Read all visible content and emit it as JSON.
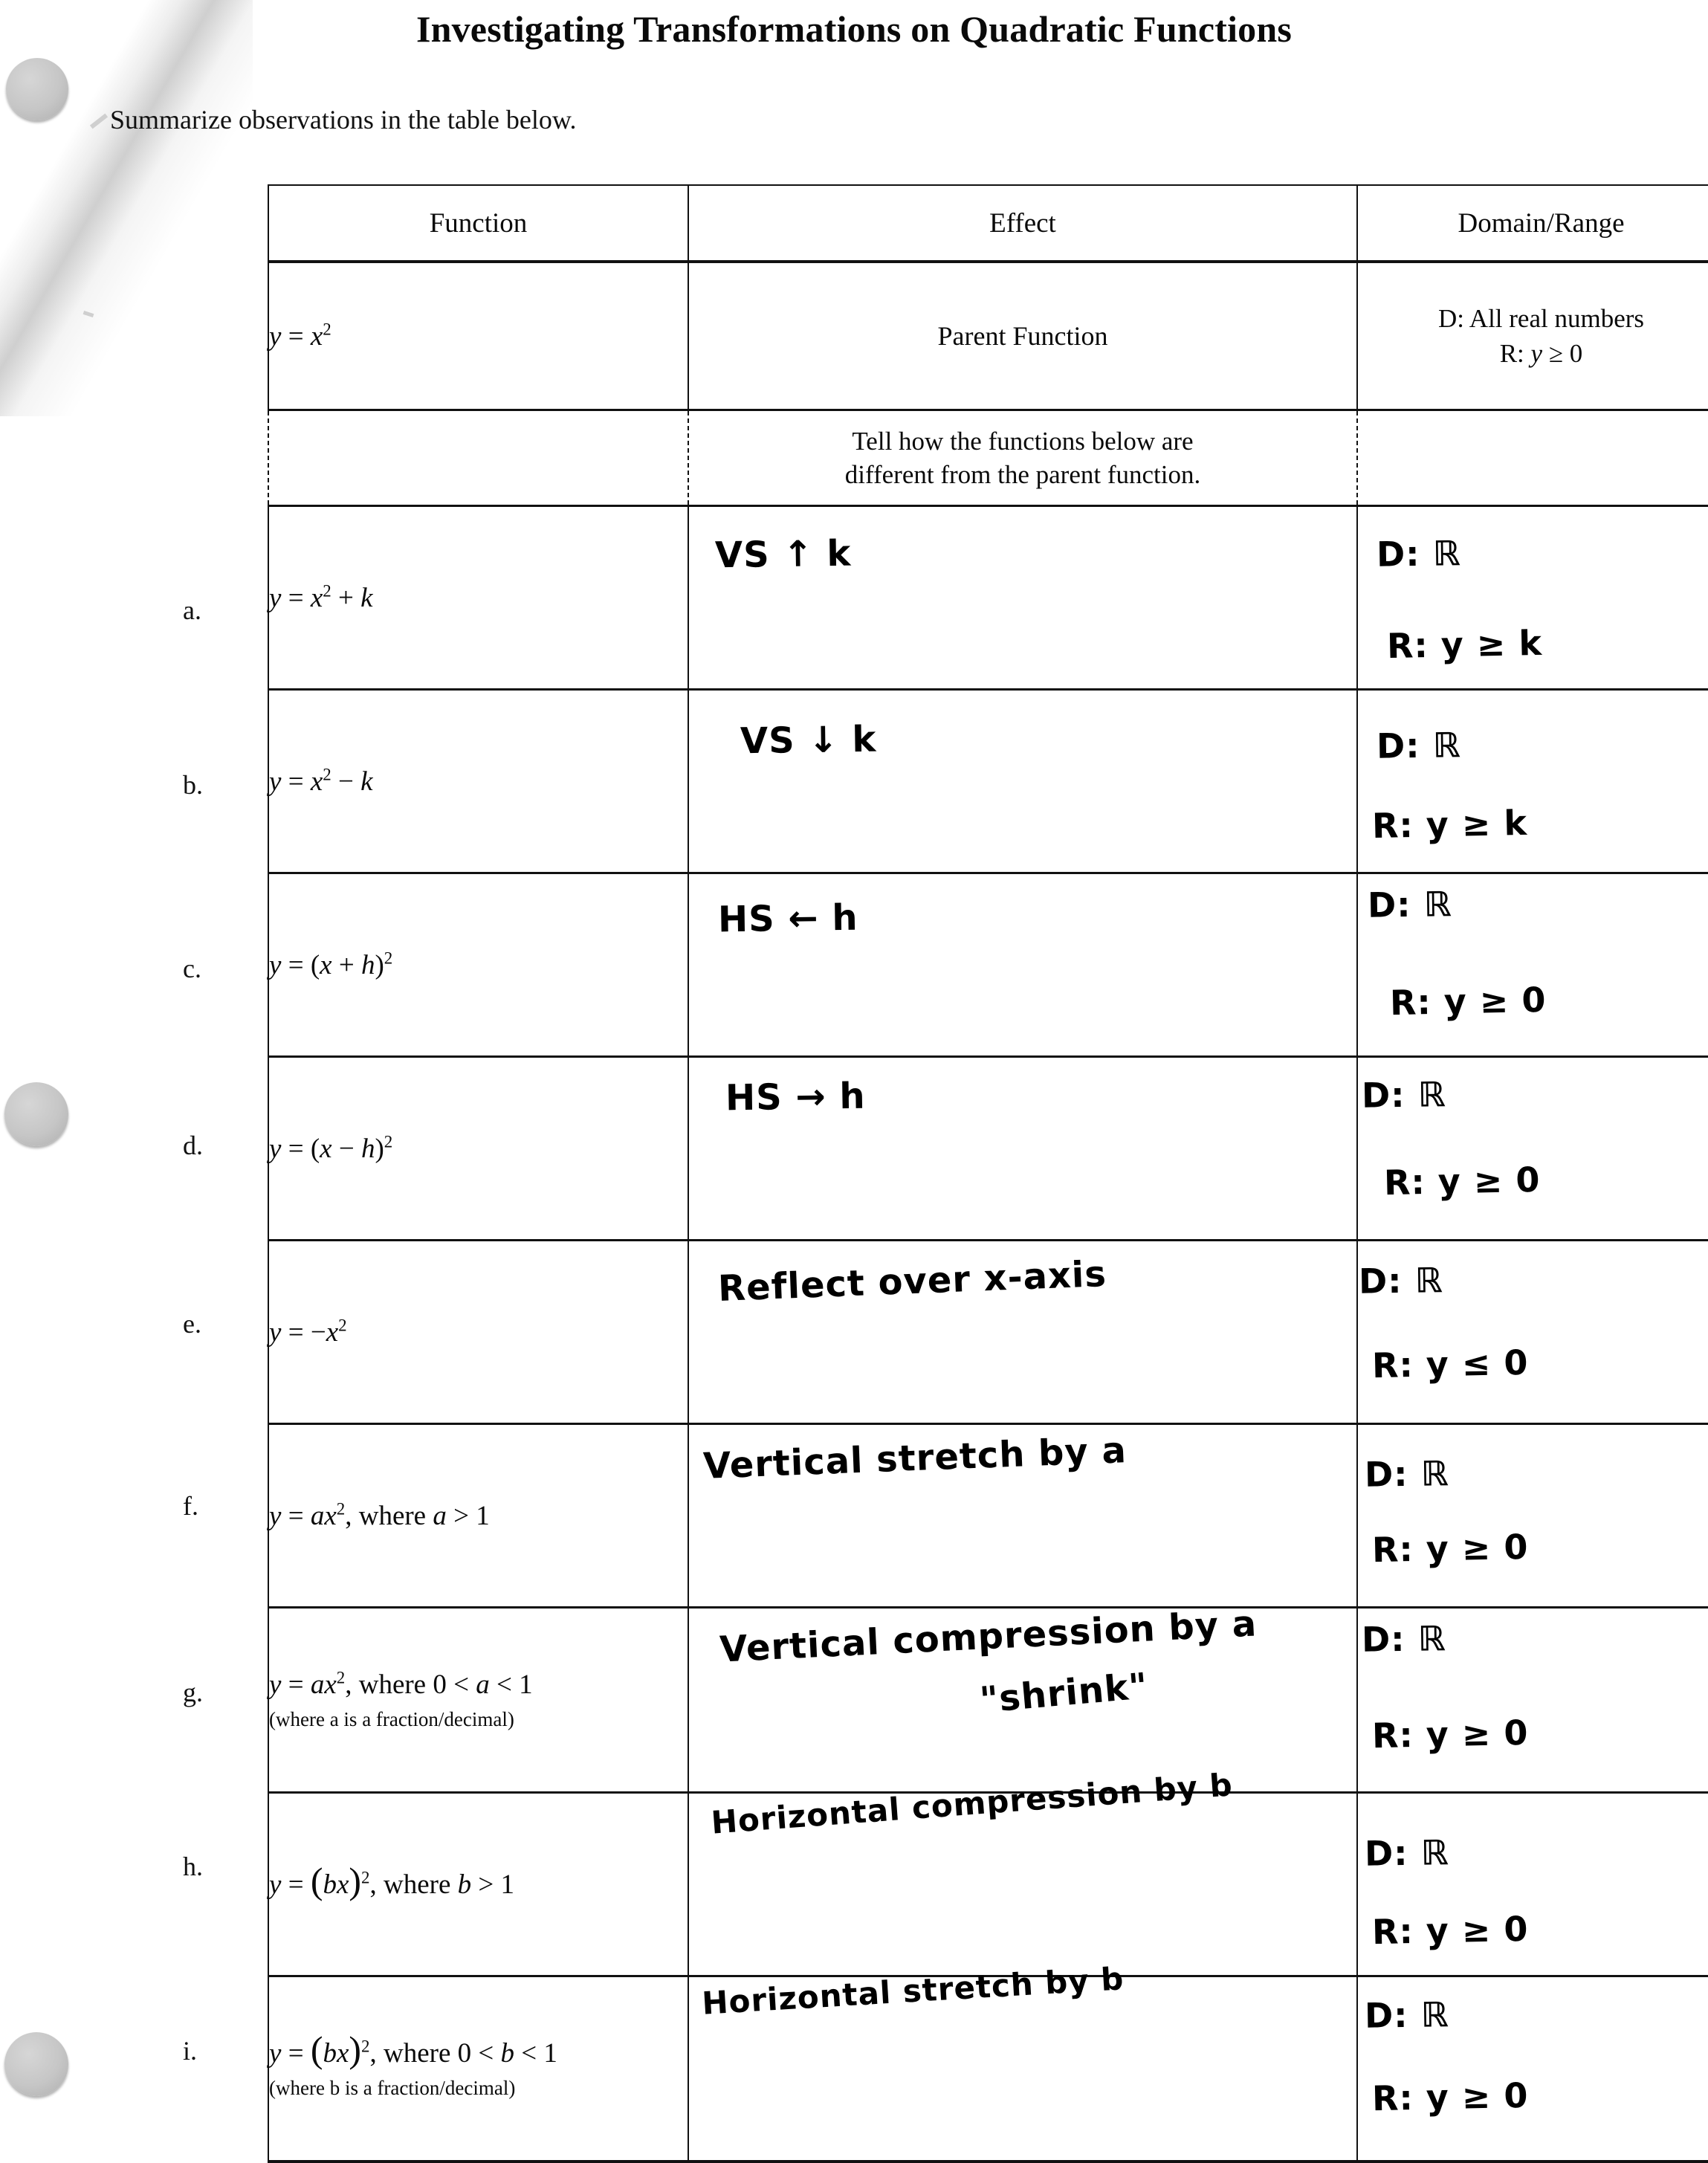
{
  "document": {
    "title": "Investigating Transformations on Quadratic Functions",
    "instruction": "Summarize observations in the table below."
  },
  "table": {
    "headers": {
      "function": "Function",
      "effect": "Effect",
      "domain_range": "Domain/Range"
    },
    "parent_row": {
      "function": "y = x²",
      "effect": "Parent Function",
      "domain": "D: All real numbers",
      "range": "R: y ≥ 0"
    },
    "note_row": {
      "line1": "Tell how the functions below are",
      "line2": "different from the parent function."
    },
    "rows": [
      {
        "letter": "a.",
        "function": "y = x² + k",
        "effect_handwritten": "VS ↑ k",
        "domain_handwritten": "D: ℝ",
        "range_handwritten": "R: y ≥ k"
      },
      {
        "letter": "b.",
        "function": "y = x² − k",
        "effect_handwritten": "VS ↓ k",
        "domain_handwritten": "D: ℝ",
        "range_handwritten": "R: y ≥ k"
      },
      {
        "letter": "c.",
        "function": "y = (x + h)²",
        "effect_handwritten": "HS ← h",
        "domain_handwritten": "D: ℝ",
        "range_handwritten": "R: y ≥ 0"
      },
      {
        "letter": "d.",
        "function": "y = (x − h)²",
        "effect_handwritten": "HS → h",
        "domain_handwritten": "D: ℝ",
        "range_handwritten": "R: y ≥ 0"
      },
      {
        "letter": "e.",
        "function": "y = −x²",
        "effect_handwritten": "Reflect over x-axis",
        "domain_handwritten": "D: ℝ",
        "range_handwritten": "R: y ≤ 0"
      },
      {
        "letter": "f.",
        "function": "y = ax², where a > 1",
        "effect_handwritten": "Vertical stretch by a",
        "domain_handwritten": "D: ℝ",
        "range_handwritten": "R: y ≥ 0"
      },
      {
        "letter": "g.",
        "function": "y = ax², where 0 < a < 1",
        "function_note": "(where a is a fraction/decimal)",
        "effect_handwritten": "Vertical compression by a",
        "effect_handwritten_line2": "\"shrink\"",
        "domain_handwritten": "D: ℝ",
        "range_handwritten": "R: y ≥ 0"
      },
      {
        "letter": "h.",
        "function": "y = (bx)², where b > 1",
        "effect_handwritten": "Horizontal compression by b",
        "domain_handwritten": "D: ℝ",
        "range_handwritten": "R: y ≥ 0"
      },
      {
        "letter": "i.",
        "function": "y = (bx)², where 0 < b < 1",
        "function_note": "(where b is a fraction/decimal)",
        "effect_handwritten": "Horizontal stretch by b",
        "domain_handwritten": "D: ℝ",
        "range_handwritten": "R: y ≥ 0"
      }
    ]
  },
  "scan_artifacts": {
    "hole_punch_count": 3,
    "ink_color": "#000000",
    "paper_color": "#ffffff"
  }
}
